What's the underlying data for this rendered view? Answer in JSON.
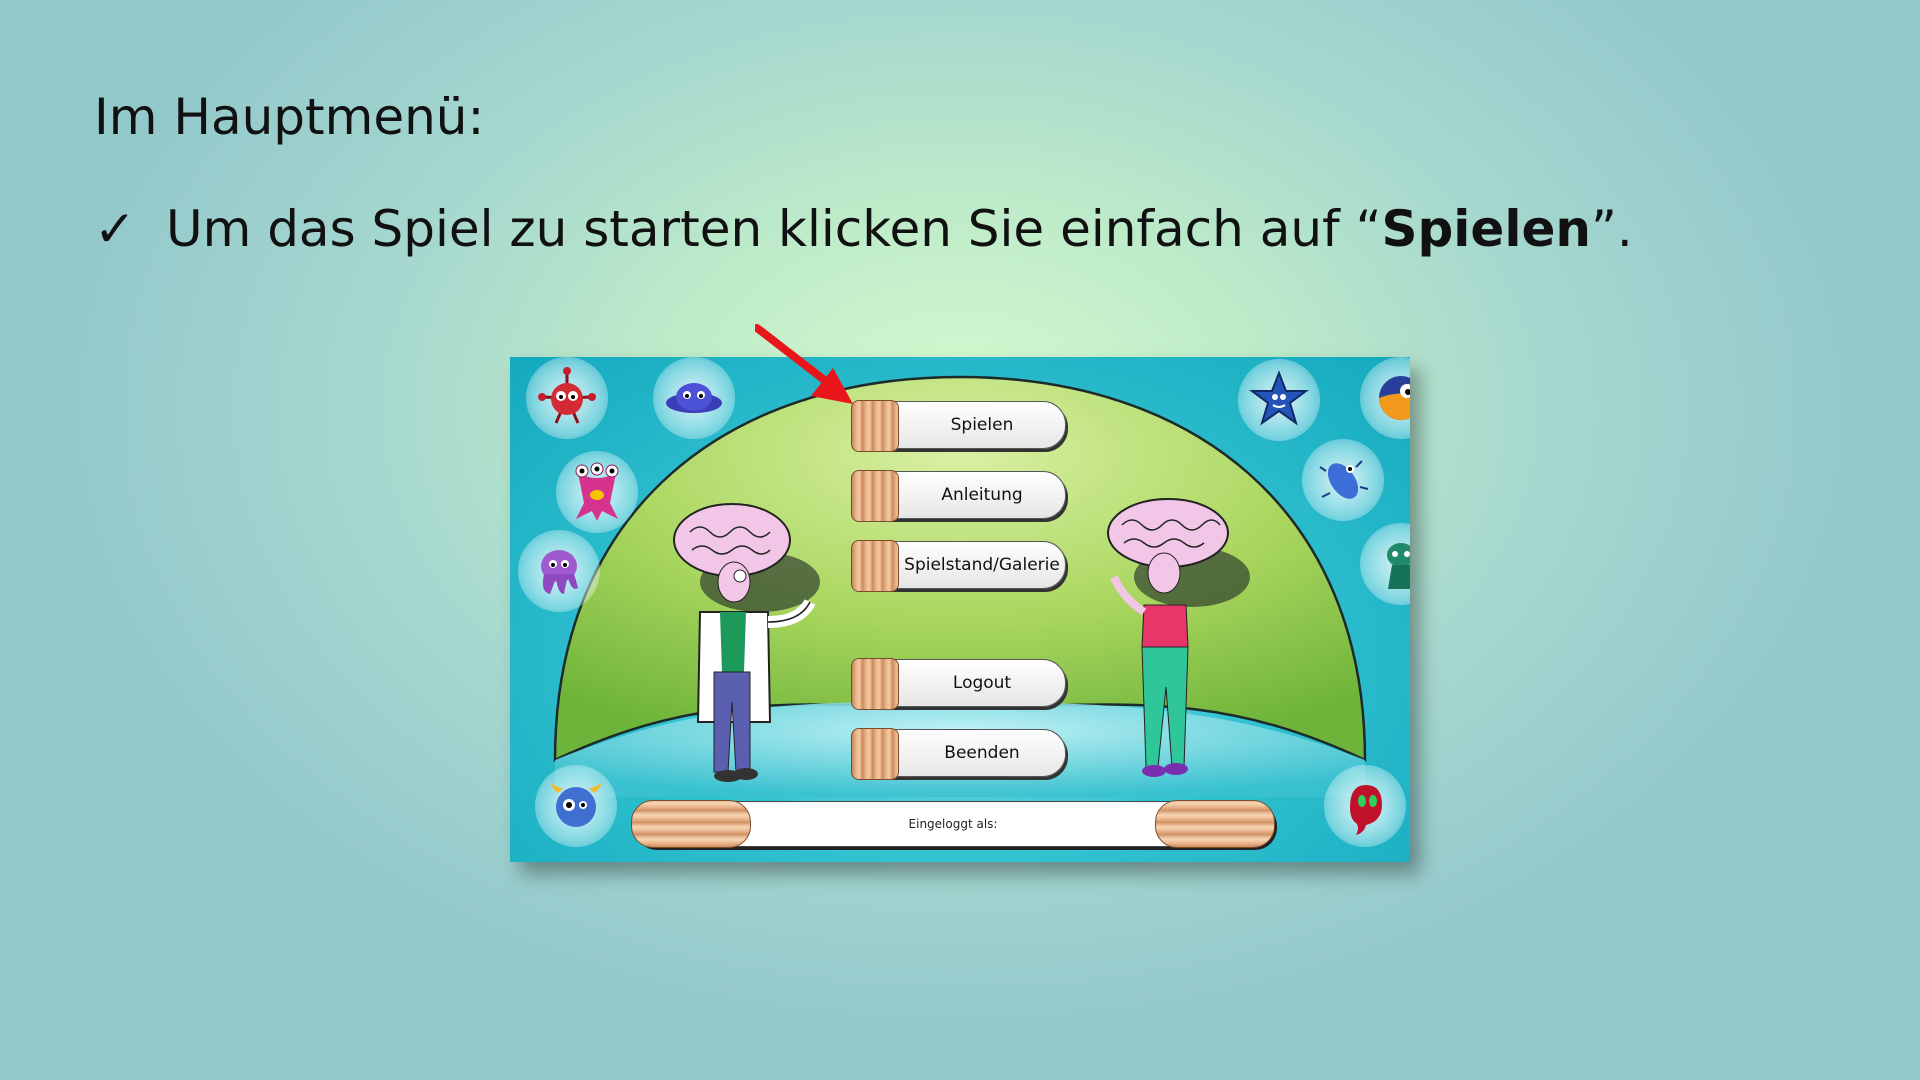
{
  "slide": {
    "title": "Im Hauptmenü:",
    "bullet_check": "✓",
    "bullet_text_before": "Um das Spiel zu starten klicken Sie einfach auf “",
    "bullet_text_bold": "Spielen",
    "bullet_text_after": "”."
  },
  "game_menu": {
    "buttons": [
      {
        "label": "Spielen"
      },
      {
        "label": "Anleitung"
      },
      {
        "label": "Spielstand/Galerie"
      },
      {
        "label": "Logout"
      },
      {
        "label": "Beenden"
      }
    ],
    "login_status_label": "Eingeloggt als:"
  },
  "colors": {
    "pointer_arrow": "#e8161b",
    "dome": "#8cc63f",
    "game_background": "#1fb3c6"
  },
  "icons": {
    "arrow": "red-pointer-arrow-icon",
    "check": "checkmark-icon"
  }
}
